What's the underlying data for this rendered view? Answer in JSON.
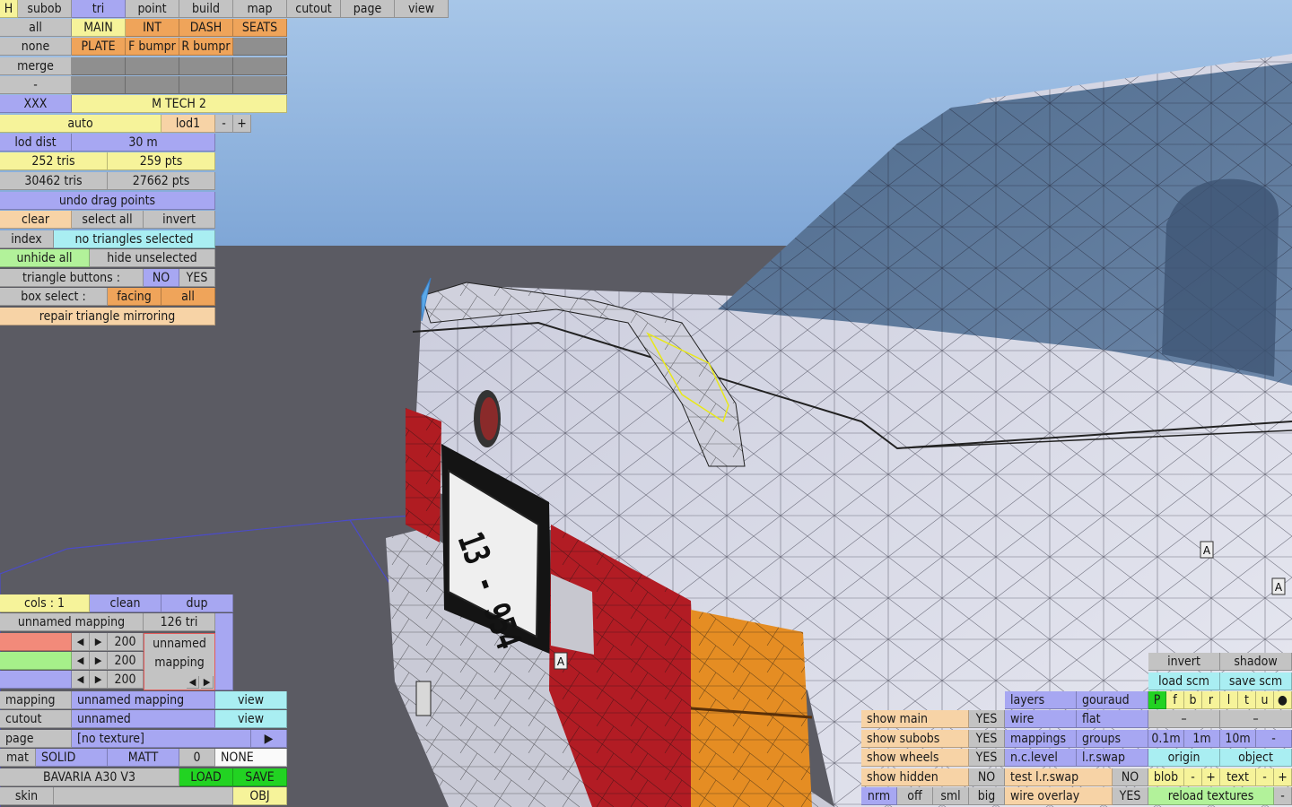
{
  "top_menu": {
    "h": "H",
    "subob": "subob",
    "tri": "tri",
    "point": "point",
    "build": "build",
    "map": "map",
    "cutout": "cutout",
    "page": "page",
    "view": "view"
  },
  "select": {
    "all": "all",
    "none": "none",
    "merge": "merge",
    "dash": "-",
    "xxx": "XXX"
  },
  "subobjects": {
    "main": "MAIN",
    "int": "INT",
    "dash": "DASH",
    "seats": "SEATS",
    "plate": "PLATE",
    "f_bumpr": "F bumpr",
    "r_bumpr": "R bumpr",
    "name": "M TECH 2"
  },
  "lod": {
    "auto": "auto",
    "lod": "lod1",
    "minus": "-",
    "plus": "+",
    "dist_label": "lod dist",
    "dist_value": "30 m"
  },
  "stats": {
    "sel_tris": "252 tris",
    "sel_pts": "259 pts",
    "total_tris": "30462 tris",
    "total_pts": "27662 pts"
  },
  "tri_tools": {
    "undo": "undo drag points",
    "clear": "clear",
    "select_all": "select all",
    "invert": "invert",
    "index": "index",
    "index_status": "no triangles selected",
    "unhide_all": "unhide all",
    "hide_unselected": "hide unselected",
    "triangle_buttons": "triangle buttons :",
    "no": "NO",
    "yes": "YES",
    "box_select": "box select :",
    "facing": "facing",
    "all": "all",
    "repair": "repair triangle mirroring"
  },
  "mapping_panel": {
    "cols": "cols : 1",
    "clean": "clean",
    "dup": "dup",
    "mapping_name": "unnamed mapping",
    "tri_count": "126 tri",
    "val1": "200",
    "val2": "200",
    "val3": "200",
    "name_line1": "unnamed",
    "name_line2": "mapping",
    "mapping": "mapping",
    "mapping_value": "unnamed mapping",
    "view1": "view",
    "cutout": "cutout",
    "cutout_value": "unnamed",
    "view2": "view",
    "page": "page",
    "page_value": "[no texture]",
    "arrow": "▶",
    "mat": "mat",
    "solid": "SOLID",
    "matt": "MATT",
    "zero": "0",
    "none": "NONE",
    "car_name": "BAVARIA A30 V3",
    "load": "LOAD",
    "save": "SAVE",
    "skin": "skin",
    "obj": "OBJ"
  },
  "view_panel": {
    "invert": "invert",
    "shadow": "shadow",
    "load_scm": "load scm",
    "save_scm": "save scm",
    "letters": [
      "P",
      "f",
      "b",
      "r",
      "l",
      "t",
      "u",
      "●"
    ],
    "layers": "layers",
    "gouraud": "gouraud",
    "show_main": "show main",
    "show_main_v": "YES",
    "wire": "wire",
    "flat": "flat",
    "show_subobs": "show subobs",
    "show_subobs_v": "YES",
    "mappings": "mappings",
    "groups": "groups",
    "show_wheels": "show wheels",
    "show_wheels_v": "YES",
    "nc_level": "n.c.level",
    "lr_swap": "l.r.swap",
    "show_hidden": "show hidden",
    "show_hidden_v": "NO",
    "test_swap": "test l.r.swap",
    "test_swap_v": "NO",
    "nrm": "nrm",
    "off": "off",
    "sml": "sml",
    "big": "big",
    "wire_overlay": "wire overlay",
    "wire_overlay_v": "YES",
    "dash": "–",
    "g01": "0.1m",
    "g1": "1m",
    "g10": "10m",
    "origin": "origin",
    "object": "object",
    "blob": "blob",
    "text": "text",
    "minus": "-",
    "plus": "+",
    "reload": "reload textures",
    "marker": "A"
  },
  "plate_text": "13 - 954",
  "colors": {
    "sky": "#93bce6",
    "floor": "#5a5a61",
    "car": "#d9d9e6",
    "taillight": "#b31d24",
    "indicator": "#e58d23"
  }
}
